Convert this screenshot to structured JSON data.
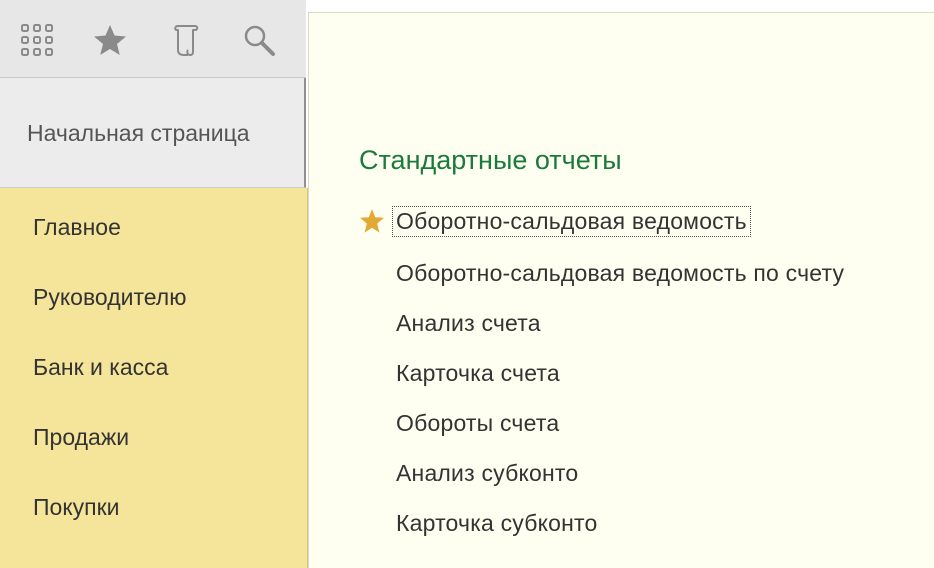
{
  "toolbar": {
    "icons": [
      "apps-grid-icon",
      "star-icon",
      "history-scroll-icon",
      "search-icon"
    ]
  },
  "home_tab": {
    "label": "Начальная страница"
  },
  "sections": {
    "items": [
      {
        "label": "Главное"
      },
      {
        "label": "Руководителю"
      },
      {
        "label": "Банк и касса"
      },
      {
        "label": "Продажи"
      },
      {
        "label": "Покупки"
      }
    ]
  },
  "main": {
    "group_title": "Стандартные отчеты",
    "reports": [
      {
        "label": "Оборотно-сальдовая ведомость",
        "favorite": true,
        "selected": true
      },
      {
        "label": "Оборотно-сальдовая ведомость по счету"
      },
      {
        "label": "Анализ счета"
      },
      {
        "label": "Карточка счета"
      },
      {
        "label": "Обороты счета"
      },
      {
        "label": "Анализ субконто"
      },
      {
        "label": "Карточка субконто"
      }
    ]
  },
  "colors": {
    "sections_bg": "#f5e59a",
    "main_bg": "#fffff1",
    "group_title": "#1a7a3c",
    "favorite_star": "#e2a935"
  }
}
